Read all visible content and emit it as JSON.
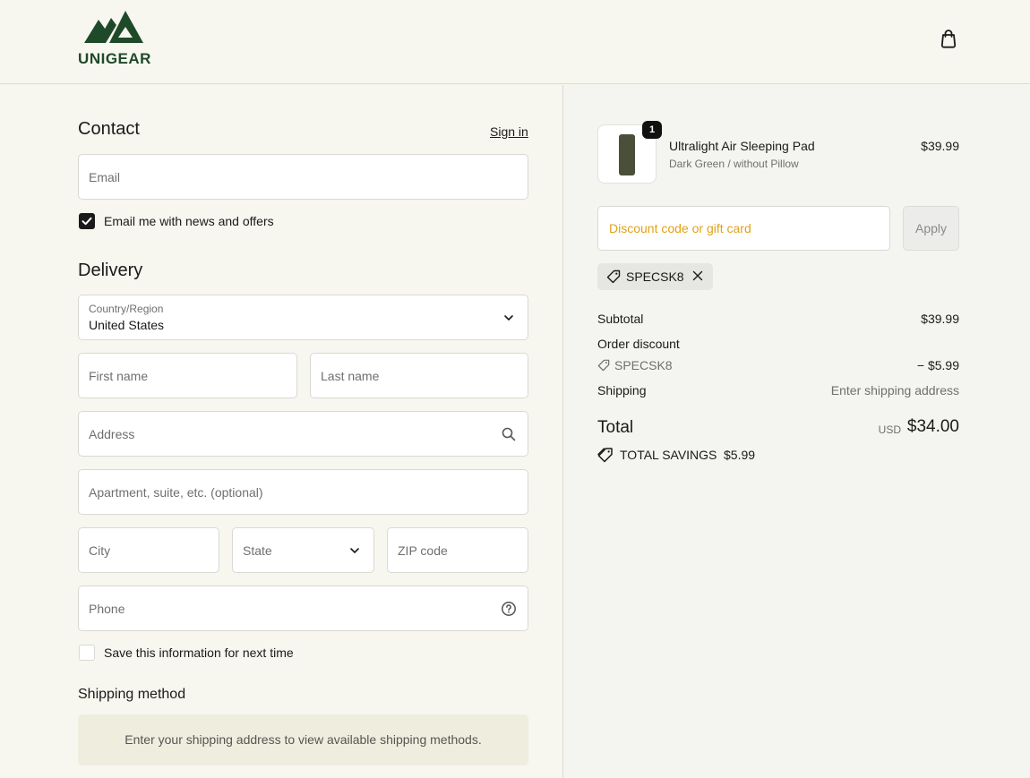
{
  "header": {
    "logo_text": "UNIGEAR",
    "cart_icon": "shopping-bag-icon"
  },
  "contact": {
    "title": "Contact",
    "sign_in": "Sign in",
    "email_placeholder": "Email",
    "newsletter_label": "Email me with news and offers",
    "newsletter_checked": true
  },
  "delivery": {
    "title": "Delivery",
    "country_label": "Country/Region",
    "country_value": "United States",
    "first_name_placeholder": "First name",
    "last_name_placeholder": "Last name",
    "address_placeholder": "Address",
    "apartment_placeholder": "Apartment, suite, etc. (optional)",
    "city_placeholder": "City",
    "state_placeholder": "State",
    "zip_placeholder": "ZIP code",
    "phone_placeholder": "Phone",
    "save_info_label": "Save this information for next time",
    "save_info_checked": false
  },
  "shipping_method": {
    "title": "Shipping method",
    "info": "Enter your shipping address to view available shipping methods."
  },
  "order": {
    "item": {
      "name": "Ultralight Air Sleeping Pad",
      "variant": "Dark Green / without Pillow",
      "price": "$39.99",
      "quantity": "1"
    },
    "discount_placeholder": "Discount code or gift card",
    "apply_label": "Apply",
    "applied_code": "SPECSK8",
    "subtotal_label": "Subtotal",
    "subtotal_value": "$39.99",
    "order_discount_label": "Order discount",
    "discount_code": "SPECSK8",
    "discount_value": "− $5.99",
    "shipping_label": "Shipping",
    "shipping_value": "Enter shipping address",
    "total_label": "Total",
    "total_currency": "USD",
    "total_value": "$34.00",
    "savings_label": "TOTAL SAVINGS",
    "savings_value": "$5.99"
  },
  "colors": {
    "brand": "#1f4a2a",
    "discount_placeholder": "#e0a21b",
    "background": "#f7f6ef"
  }
}
